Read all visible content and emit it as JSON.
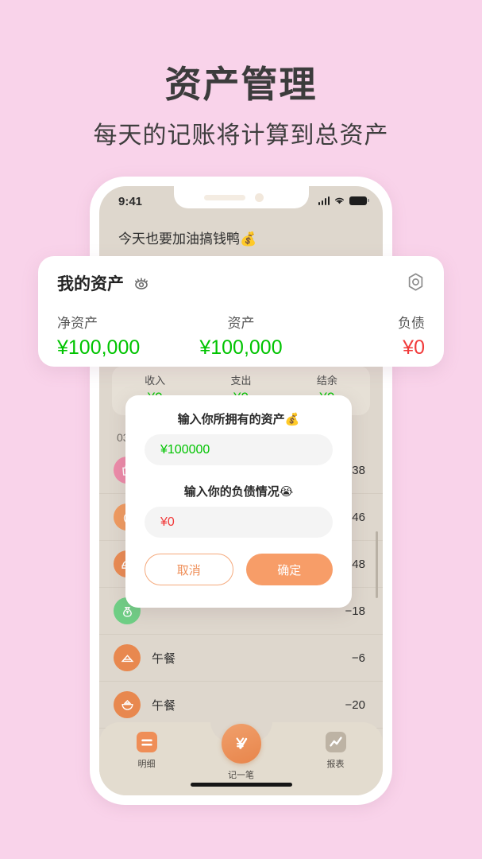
{
  "header": {
    "title": "资产管理",
    "subtitle": "每天的记账将计算到总资产"
  },
  "colors": {
    "background": "#f9d3ea",
    "screen": "#ded7cd",
    "accent_orange": "#f79d68",
    "positive_green": "#00c400",
    "negative_red": "#f13b3b",
    "tabbar": "#e3dccf"
  },
  "phone": {
    "statusbar": {
      "time": "9:41",
      "signal_icon": "cellular-bars-icon",
      "wifi_icon": "wifi-icon",
      "battery_icon": "battery-full-icon"
    },
    "greeting": "今天也要加油搞钱鸭💰",
    "summary": {
      "headers": [
        "收入",
        "支出",
        "结余"
      ],
      "values": [
        "¥0",
        "¥0",
        "¥0"
      ]
    },
    "date_group": "03月",
    "transactions": [
      {
        "icon": "shopping-bag-icon",
        "color": "#ec8aa8",
        "name": "",
        "amount": "438"
      },
      {
        "icon": "apple-icon",
        "color": "#ef9a5f",
        "name": "",
        "amount": "346"
      },
      {
        "icon": "bread-icon",
        "color": "#e98a52",
        "name": "",
        "amount": "−48"
      },
      {
        "icon": "money-bag-icon",
        "color": "#6fcf85",
        "name": "",
        "amount": "−18"
      },
      {
        "icon": "cake-icon",
        "color": "#e8884f",
        "name": "午餐",
        "amount": "−6"
      },
      {
        "icon": "bowl-icon",
        "color": "#e8884f",
        "name": "午餐",
        "amount": "−20"
      }
    ],
    "tabbar": {
      "items": [
        {
          "label": "明细",
          "icon": "list-detail-icon",
          "active": true
        },
        {
          "label": "记一笔",
          "icon": "yen-pen-icon",
          "active": false
        },
        {
          "label": "报表",
          "icon": "chart-report-icon",
          "active": false
        }
      ]
    }
  },
  "asset_card": {
    "title": "我的资产",
    "eye_icon": "eye-visible-icon",
    "settings_icon": "hex-gear-icon",
    "columns": [
      {
        "label": "净资产",
        "value": "¥100,000",
        "tone": "green"
      },
      {
        "label": "资产",
        "value": "¥100,000",
        "tone": "green"
      },
      {
        "label": "负债",
        "value": "¥0",
        "tone": "red"
      }
    ]
  },
  "dialog": {
    "asset_label": "输入你所拥有的资产💰",
    "asset_value": "¥100000",
    "asset_placeholder": "¥100000",
    "debt_label": "输入你的负债情况😭",
    "debt_value": "¥0",
    "debt_placeholder": "¥0",
    "cancel_label": "取消",
    "confirm_label": "确定"
  }
}
